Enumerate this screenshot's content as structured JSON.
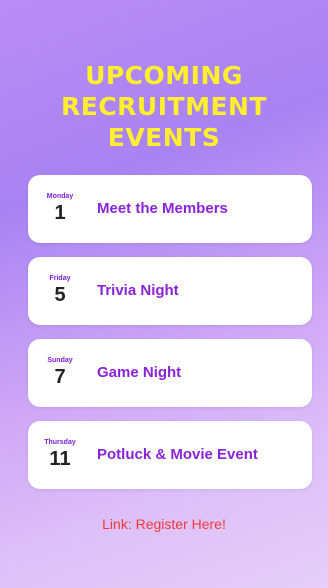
{
  "title": {
    "lines": [
      "UPCOMING",
      "RECRUITMENT",
      "EVENTS"
    ]
  },
  "events": [
    {
      "day": "Monday",
      "date": "1",
      "name": "Meet the Members"
    },
    {
      "day": "Friday",
      "date": "5",
      "name": "Trivia Night"
    },
    {
      "day": "Sunday",
      "date": "7",
      "name": "Game Night"
    },
    {
      "day": "Thursday",
      "date": "11",
      "name": "Potluck & Movie Event"
    }
  ],
  "footer": {
    "register_link": "Link: Register Here!"
  },
  "colors": {
    "title": "#ffef2e",
    "event_name": "#8a24d8",
    "day_label": "#7a1ed6",
    "link": "#f03a3f",
    "card": "#ffffff"
  }
}
